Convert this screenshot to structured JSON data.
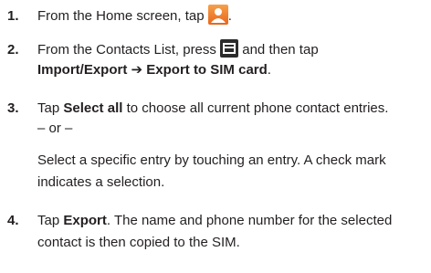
{
  "steps": [
    {
      "num": "1.",
      "pre": "From the Home screen, tap",
      "post": "."
    },
    {
      "num": "2.",
      "pre": "From the Contacts List, press",
      "mid": "and then tap",
      "path_a": "Import/Export",
      "arrow": "➔",
      "path_b": "Export to SIM card",
      "end": "."
    },
    {
      "num": "3.",
      "a": "Tap",
      "b": "Select all",
      "c": "to choose all current phone contact entries.",
      "or": "– or –",
      "line3": "Select a specific entry by touching an entry. A check mark",
      "line4": "indicates a selection."
    },
    {
      "num": "4.",
      "a": "Tap",
      "b": "Export",
      "c": ". The name and phone number for the selected",
      "line2": "contact is then copied to the SIM."
    }
  ],
  "icons": [
    "contacts-app-icon",
    "menu-key-icon"
  ],
  "colors": {
    "contacts_icon": "#f08a35",
    "menu_icon": "#2b2b2b",
    "text": "#231f20"
  }
}
